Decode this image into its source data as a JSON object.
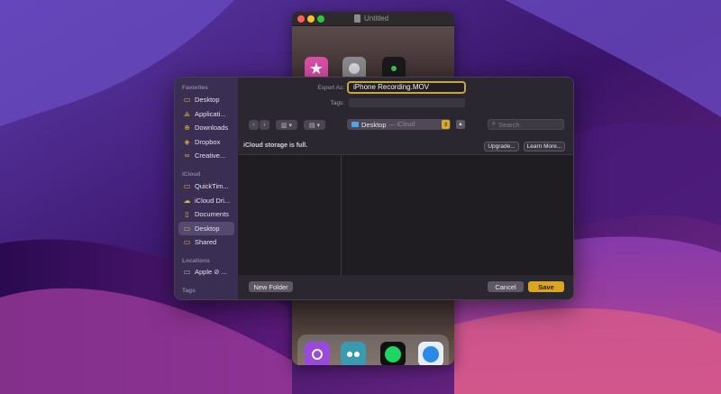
{
  "background_window": {
    "title": "Untitled"
  },
  "dialog": {
    "export_as_label": "Export As:",
    "export_as_value": "iPhone Recording.MOV",
    "tags_label": "Tags:",
    "location": {
      "name": "Desktop",
      "sub": "— iCloud"
    },
    "search_placeholder": "Search",
    "storage_message": "iCloud storage is full.",
    "upgrade_button": "Upgrade...",
    "learn_more_button": "Learn More...",
    "new_folder_button": "New Folder",
    "cancel_button": "Cancel",
    "save_button": "Save"
  },
  "sidebar": {
    "favorites_header": "Favorites",
    "favorites": [
      {
        "label": "Desktop",
        "icon": "desktop-icon"
      },
      {
        "label": "Applicati...",
        "icon": "applications-icon"
      },
      {
        "label": "Downloads",
        "icon": "downloads-icon"
      },
      {
        "label": "Dropbox",
        "icon": "dropbox-icon"
      },
      {
        "label": "Creative...",
        "icon": "creative-cloud-icon"
      }
    ],
    "icloud_header": "iCloud",
    "icloud": [
      {
        "label": "QuickTim...",
        "icon": "folder-icon"
      },
      {
        "label": "iCloud Dri...",
        "icon": "cloud-icon"
      },
      {
        "label": "Documents",
        "icon": "document-icon"
      },
      {
        "label": "Desktop",
        "icon": "desktop-icon",
        "selected": true
      },
      {
        "label": "Shared",
        "icon": "shared-folder-icon"
      }
    ],
    "locations_header": "Locations",
    "locations": [
      {
        "label": "Apple ⊘ ...",
        "icon": "laptop-icon"
      }
    ],
    "tags_header": "Tags"
  },
  "colors": {
    "accent": "#dba521",
    "sidebar_bg": "#3a2e52",
    "dialog_bg": "#2b2730"
  }
}
